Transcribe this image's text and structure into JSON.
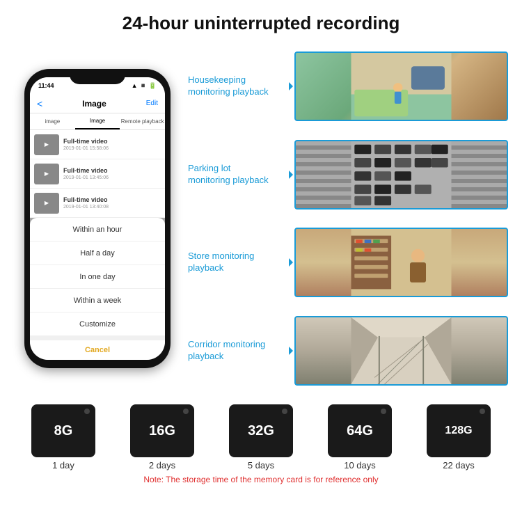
{
  "header": {
    "title": "24-hour uninterrupted recording"
  },
  "phone": {
    "time": "11:44",
    "nav": {
      "back": "<",
      "title": "Image",
      "edit": "Edit"
    },
    "tabs": [
      {
        "label": "image",
        "active": false
      },
      {
        "label": "Image",
        "active": true
      },
      {
        "label": "Remote playback",
        "active": false
      }
    ],
    "videos": [
      {
        "title": "Full-time video",
        "date": "2019-01-01 15:58:06"
      },
      {
        "title": "Full-time video",
        "date": "2019-01-01 13:45:06"
      },
      {
        "title": "Full-time video",
        "date": "2019-01-01 13:40:08"
      }
    ],
    "dropdown": {
      "items": [
        "Within an hour",
        "Half a day",
        "In one day",
        "Within a week",
        "Customize"
      ],
      "cancel": "Cancel"
    }
  },
  "monitoring": [
    {
      "label": "Housekeeping\nmonitoring playback",
      "image_type": "housekeeping"
    },
    {
      "label": "Parking lot\nmonitoring playback",
      "image_type": "parking"
    },
    {
      "label": "Store monitoring\nplayback",
      "image_type": "store"
    },
    {
      "label": "Corridor monitoring\nplayback",
      "image_type": "corridor"
    }
  ],
  "storage": {
    "cards": [
      {
        "size": "8G",
        "days": "1 day"
      },
      {
        "size": "16G",
        "days": "2 days"
      },
      {
        "size": "32G",
        "days": "5 days"
      },
      {
        "size": "64G",
        "days": "10 days"
      },
      {
        "size": "128G",
        "days": "22 days"
      }
    ],
    "note": "Note: The storage time of the memory card is for reference only"
  }
}
